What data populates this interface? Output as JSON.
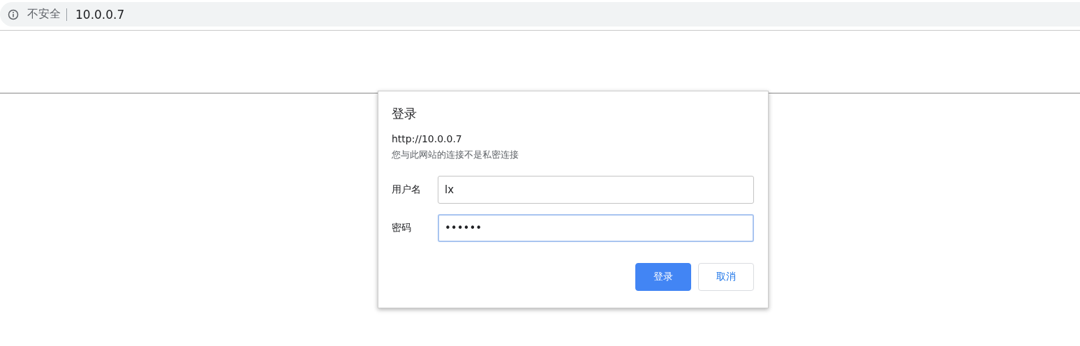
{
  "address_bar": {
    "security_label": "不安全",
    "url": "10.0.0.7"
  },
  "dialog": {
    "title": "登录",
    "origin": "http://10.0.0.7",
    "warning": "您与此网站的连接不是私密连接",
    "fields": [
      {
        "label": "用户名",
        "value": "lx",
        "focused": false
      },
      {
        "label": "密码",
        "value": "••••••",
        "focused": true
      }
    ],
    "buttons": [
      {
        "label": "登录",
        "kind": "primary"
      },
      {
        "label": "取消",
        "kind": "secondary"
      }
    ]
  }
}
